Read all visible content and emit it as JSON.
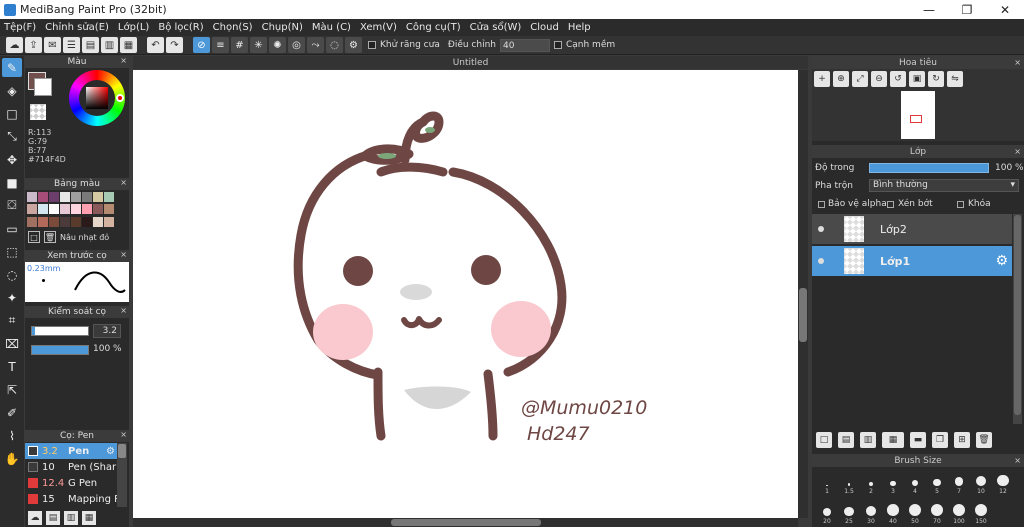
{
  "window": {
    "title": "MediBang Paint Pro (32bit)",
    "min": "—",
    "max": "❐",
    "close": "✕"
  },
  "menu": [
    "Tệp(F)",
    "Chỉnh sửa(E)",
    "Lớp(L)",
    "Bộ lọc(R)",
    "Chọn(S)",
    "Chụp(N)",
    "Màu (C)",
    "Xem(V)",
    "Công cụ(T)",
    "Cửa sổ(W)",
    "Cloud",
    "Help"
  ],
  "toolbar": {
    "antialias_label": "Khử răng cưa",
    "adjust_label": "Điều chỉnh",
    "adjust_value": "40",
    "smooth_label": "Cạnh mềm"
  },
  "color_panel": {
    "title": "Màu",
    "r": "R:113",
    "g": "G:79",
    "b": "B:77",
    "hex": "#714F4D",
    "fg_color": "#714F4D",
    "close": "×"
  },
  "palette_panel": {
    "title": "Bảng màu",
    "swatches": [
      "#c9b9c9",
      "#a64d79",
      "#6b3e6b",
      "#e6e6e6",
      "#a0a0a0",
      "#7a7a7a",
      "#d4c9a3",
      "#a6c9b4",
      "#c9a6a0",
      "#d4e6f0",
      "#ffffff",
      "#e6c9d4",
      "#ffd6e0",
      "#ff9fb0",
      "#8a5a5a",
      "#b48a70",
      "#a07060",
      "#b46a5a",
      "#7a4a3a",
      "#4a3a3a",
      "#5a3a2a",
      "#2a1a1a",
      "#e6d6c9",
      "#d4b4a0"
    ],
    "selected_name": "Nâu nhạt đỏ"
  },
  "preview_panel": {
    "title": "Xem trước cọ",
    "size": "0.23mm"
  },
  "brush_control": {
    "title": "Kiểm soát cọ",
    "size": "3.2",
    "opacity": "100 %"
  },
  "brush_panel": {
    "title": "Cọ: Pen",
    "items": [
      {
        "size": "3.2",
        "name": "Pen",
        "color": "#3a3a3a",
        "active": true
      },
      {
        "size": "10",
        "name": "Pen (Sharp)",
        "color": "#3a3a3a",
        "active": false
      },
      {
        "size": "12.4",
        "name": "G Pen",
        "color": "#e03a3a",
        "active": false
      },
      {
        "size": "15",
        "name": "Mapping Pen",
        "color": "#e03a3a",
        "active": false
      }
    ]
  },
  "canvas": {
    "title": "Untitled",
    "signature_line1": "@Mumu0210",
    "signature_line2": "Hd247"
  },
  "navigator": {
    "title": "Hoa tiêu"
  },
  "layers": {
    "title": "Lớp",
    "opacity_label": "Độ trong",
    "opacity_value": "100 %",
    "blend_label": "Pha trộn",
    "blend_value": "Bình thường",
    "protect_alpha": "Bảo vệ alpha",
    "clipping": "Xén bớt",
    "lock": "Khóa",
    "items": [
      {
        "name": "Lớp2",
        "selected": false
      },
      {
        "name": "Lớp1",
        "selected": true
      }
    ]
  },
  "brush_size": {
    "title": "Brush Size",
    "row1": [
      "1",
      "1.5",
      "2",
      "3",
      "4",
      "5",
      "7",
      "10",
      "12"
    ],
    "row2": [
      "20",
      "25",
      "30",
      "40",
      "50",
      "70",
      "100",
      "150"
    ]
  }
}
